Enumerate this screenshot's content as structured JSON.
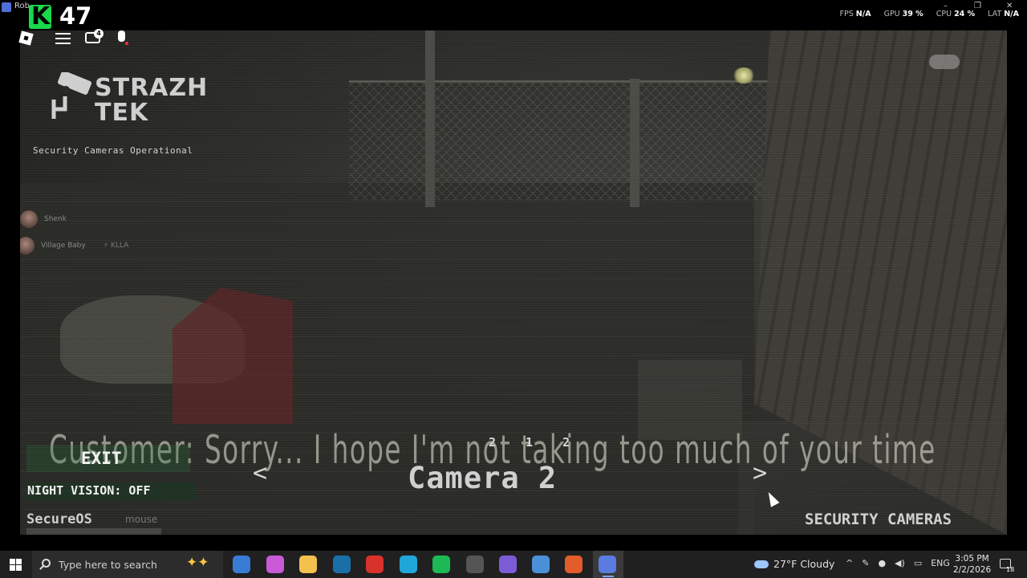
{
  "window": {
    "title": "Rob",
    "minimize": "–",
    "maximize": "❐",
    "close": "✕"
  },
  "overlay": {
    "k_letter": "K",
    "k_count": "47",
    "stats": [
      {
        "label": "FPS",
        "value": "N/A"
      },
      {
        "label": "GPU",
        "value": "39 %"
      },
      {
        "label": "CPU",
        "value": "24 %"
      },
      {
        "label": "LAT",
        "value": "N/A"
      }
    ]
  },
  "roblox_controls": {
    "chat_badge": "4",
    "icons": [
      "roblox-logo-icon",
      "menu-icon",
      "chat-icon",
      "microphone-icon"
    ]
  },
  "game": {
    "logo_line1": "STRAZH",
    "logo_line2": "TEK",
    "status": "Security Cameras Operational",
    "players": [
      {
        "name": "Shenk",
        "tag": ""
      },
      {
        "name": "Village Baby",
        "tag": "⚡ KLLA"
      }
    ],
    "subtitle": "Customer: Sorry... I hope I'm not taking too much of your time",
    "exit_label": "EXIT",
    "night_vision_label": "NIGHT VISION: OFF",
    "os_label": "SecureOS",
    "os_hint": "mouse",
    "camera_prev": "<",
    "camera_next": ">",
    "camera_name": "Camera 2",
    "camera_time": "2 1 2",
    "panel_label": "SECURITY CAMERAS"
  },
  "taskbar": {
    "search_placeholder": "Type here to search",
    "apps": [
      {
        "name": "store-icon",
        "color": "#3a7bd5"
      },
      {
        "name": "copilot-icon",
        "color": "#c85ad6"
      },
      {
        "name": "file-explorer-icon",
        "color": "#f2c14e"
      },
      {
        "name": "steam-icon",
        "color": "#1b6fa8"
      },
      {
        "name": "wps-icon",
        "color": "#d9322b"
      },
      {
        "name": "edge-icon",
        "color": "#1fa7d9"
      },
      {
        "name": "spotify-icon",
        "color": "#1db954"
      },
      {
        "name": "obs-icon",
        "color": "#555555"
      },
      {
        "name": "discord-icon",
        "color": "#7b5cd6"
      },
      {
        "name": "app-window-icon",
        "color": "#4a90d9"
      },
      {
        "name": "brave-icon",
        "color": "#e25c2c"
      },
      {
        "name": "roblox-icon",
        "color": "#5b7be0"
      }
    ],
    "weather": "27°F  Cloudy",
    "language": "ENG",
    "time": "3:05 PM",
    "date": "2/2/2026",
    "notification_count": "18"
  }
}
